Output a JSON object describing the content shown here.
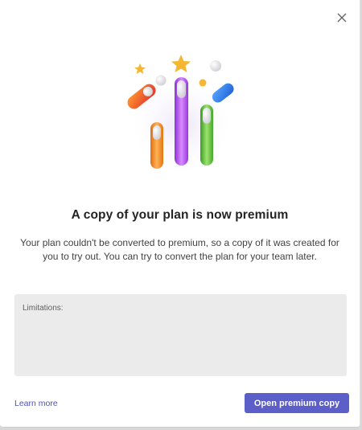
{
  "dialog": {
    "title": "A copy of your plan is now premium",
    "description": "Your plan couldn't be converted to premium, so a copy of it was created for you to try out. You can try to convert the plan for your team later.",
    "limitations_label": "Limitations:",
    "learn_more": "Learn more",
    "primary_button": "Open premium copy",
    "close_icon": "close-icon"
  },
  "hero": {
    "icon": "celebration-illustration",
    "colors": {
      "orange": "#f08a1c",
      "purple": "#b44ef0",
      "green": "#5cc23b",
      "red": "#e84a3a",
      "blue": "#2f7fe8",
      "star": "#f5b731"
    }
  },
  "theme": {
    "accent": "#5b5fc7",
    "link": "#4f52b2",
    "panel": "#ebebeb"
  }
}
